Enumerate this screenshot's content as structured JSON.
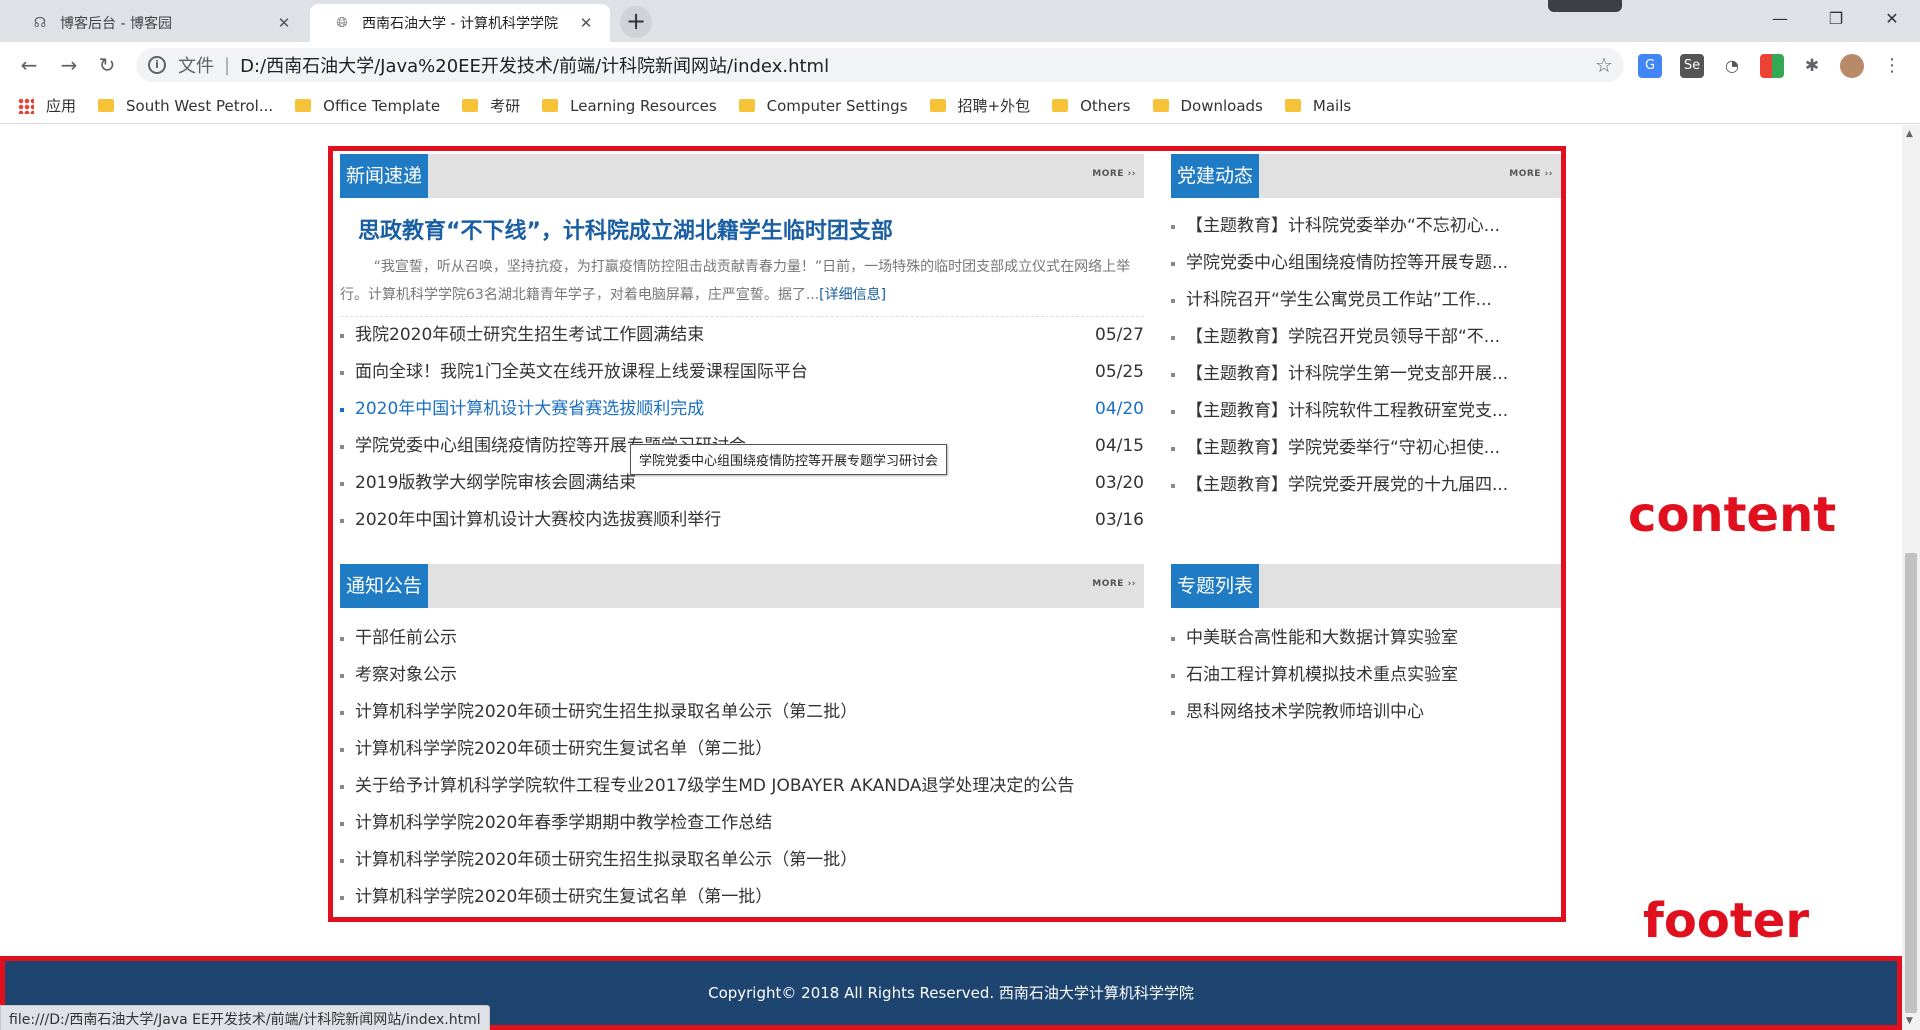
{
  "browser": {
    "tabs": [
      {
        "title": "博客后台 - 博客园",
        "icon": "cnblogs-icon"
      },
      {
        "title": "西南石油大学 - 计算机科学学院",
        "icon": "globe-icon"
      }
    ],
    "address": {
      "scheme_label": "文件",
      "url": "D:/西南石油大学/Java%20EE开发技术/前端/计科院新闻网站/index.html"
    },
    "bookmarks": [
      {
        "label": "应用",
        "type": "apps"
      },
      {
        "label": "South West Petrol...",
        "type": "folder"
      },
      {
        "label": "Office Template",
        "type": "folder"
      },
      {
        "label": "考研",
        "type": "folder"
      },
      {
        "label": "Learning Resources",
        "type": "folder"
      },
      {
        "label": "Computer Settings",
        "type": "folder"
      },
      {
        "label": "招聘+外包",
        "type": "folder"
      },
      {
        "label": "Others",
        "type": "folder"
      },
      {
        "label": "Downloads",
        "type": "folder"
      },
      {
        "label": "Mails",
        "type": "folder"
      }
    ],
    "status_url": "file:///D:/西南石油大学/Java EE开发技术/前端/计科院新闻网站/index.html"
  },
  "annotations": {
    "content": "content",
    "footer": "footer"
  },
  "news": {
    "title": "新闻速递",
    "more": "MORE",
    "headline": "思政教育“不下线”，计科院成立湖北籍学生临时团支部",
    "summary": "“我宣誓，听从召唤，坚持抗疫，为打赢疫情防控阻击战贡献青春力量！”日前，一场特殊的临时团支部成立仪式在网络上举行。计算机科学学院63名湖北籍青年学子，对着电脑屏幕，庄严宣誓。据了...",
    "summary_link": "[详细信息]",
    "items": [
      {
        "title": "我院2020年硕士研究生招生考试工作圆满结束",
        "date": "05/27"
      },
      {
        "title": "面向全球！我院1门全英文在线开放课程上线爱课程国际平台",
        "date": "05/25"
      },
      {
        "title": "2020年中国计算机设计大赛省赛选拔顺利完成",
        "date": "04/20"
      },
      {
        "title": "学院党委中心组围绕疫情防控等开展专题学习研讨会",
        "date": "04/15"
      },
      {
        "title": "2019版教学大纲学院审核会圆满结束",
        "date": "03/20"
      },
      {
        "title": "2020年中国计算机设计大赛校内选拔赛顺利举行",
        "date": "03/16"
      }
    ],
    "tooltip": "学院党委中心组围绕疫情防控等开展专题学习研讨会"
  },
  "party": {
    "title": "党建动态",
    "more": "MORE",
    "items": [
      "【主题教育】计科院党委举办“不忘初心...",
      "学院党委中心组围绕疫情防控等开展专题...",
      "计科院召开“学生公寓党员工作站”工作...",
      "【主题教育】学院召开党员领导干部“不...",
      "【主题教育】计科院学生第一党支部开展...",
      "【主题教育】计科院软件工程教研室党支...",
      "【主题教育】学院党委举行“守初心担使...",
      "【主题教育】学院党委开展党的十九届四..."
    ]
  },
  "notice": {
    "title": "通知公告",
    "more": "MORE",
    "items": [
      "干部任前公示",
      "考察对象公示",
      "计算机科学学院2020年硕士研究生招生拟录取名单公示（第二批）",
      "计算机科学学院2020年硕士研究生复试名单（第二批）",
      "关于给予计算机科学学院软件工程专业2017级学生MD JOBAYER AKANDA退学处理决定的公告",
      "计算机科学学院2020年春季学期期中教学检查工作总结",
      "计算机科学学院2020年硕士研究生招生拟录取名单公示（第一批）",
      "计算机科学学院2020年硕士研究生复试名单（第一批）"
    ]
  },
  "topics": {
    "title": "专题列表",
    "items": [
      "中美联合高性能和大数据计算实验室",
      "石油工程计算机模拟技术重点实验室",
      "思科网络技术学院教师培训中心"
    ]
  },
  "footer": {
    "copyright": "Copyright© 2018 All Rights Reserved. 西南石油大学计算机科学学院"
  },
  "colors": {
    "accent": "#1f7bc4",
    "annotation": "#e0101f",
    "footer_bg": "#1e4470"
  }
}
